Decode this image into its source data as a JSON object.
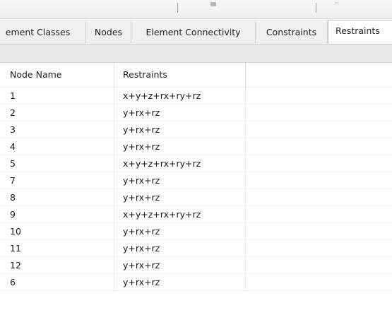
{
  "tabs": [
    {
      "label": "ement Classes",
      "active": false
    },
    {
      "label": "Nodes",
      "active": false
    },
    {
      "label": "Element Connectivity",
      "active": false
    },
    {
      "label": "Constraints",
      "active": false
    },
    {
      "label": "Restraints",
      "active": true
    }
  ],
  "table": {
    "columns": [
      "Node Name",
      "Restraints"
    ],
    "rows": [
      [
        "1",
        "x+y+z+rx+ry+rz"
      ],
      [
        "2",
        "y+rx+rz"
      ],
      [
        "3",
        "y+rx+rz"
      ],
      [
        "4",
        "y+rx+rz"
      ],
      [
        "5",
        "x+y+z+rx+ry+rz"
      ],
      [
        "7",
        "y+rx+rz"
      ],
      [
        "8",
        "y+rx+rz"
      ],
      [
        "9",
        "x+y+z+rx+ry+rz"
      ],
      [
        "10",
        "y+rx+rz"
      ],
      [
        "11",
        "y+rx+rz"
      ],
      [
        "12",
        "y+rx+rz"
      ],
      [
        "6",
        "y+rx+rz"
      ]
    ]
  }
}
